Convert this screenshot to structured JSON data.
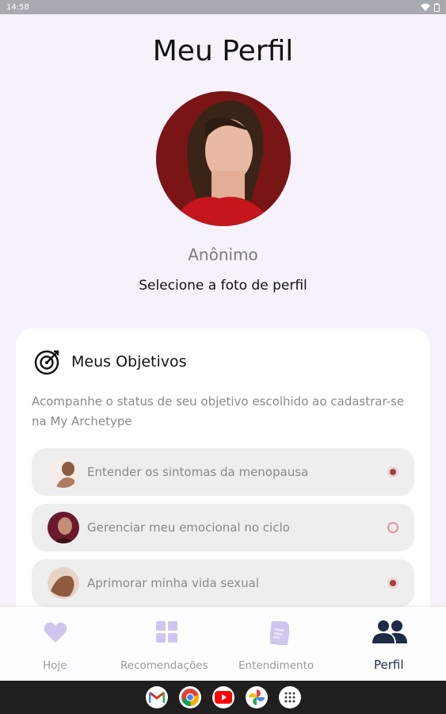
{
  "status_bar": {
    "time": "14:58"
  },
  "header": {
    "title": "Meu Perfil"
  },
  "profile": {
    "name": "Anônimo",
    "select_photo_label": "Selecione a foto de perfil"
  },
  "goals_card": {
    "title": "Meus Objetivos",
    "description": "Acompanhe o status de seu objetivo escolhido ao cadastrar-se na My Archetype",
    "items": [
      {
        "label": "Entender os sintomas da menopausa",
        "selected": true
      },
      {
        "label": "Gerenciar meu emocional no ciclo",
        "selected": false
      },
      {
        "label": "Aprimorar minha vida sexual",
        "selected": true
      }
    ]
  },
  "bottom_nav": {
    "items": [
      {
        "label": "Hoje",
        "icon": "heart-icon",
        "active": false
      },
      {
        "label": "Recomendações",
        "icon": "grid-icon",
        "active": false
      },
      {
        "label": "Entendimento",
        "icon": "document-icon",
        "active": false
      },
      {
        "label": "Perfil",
        "icon": "people-icon",
        "active": true
      }
    ]
  },
  "system_dock": {
    "apps": [
      "gmail-icon",
      "chrome-icon",
      "youtube-icon",
      "photos-icon",
      "app-drawer-icon"
    ]
  },
  "colors": {
    "accent": "#a5403e",
    "nav_inactive": "#cfc6ef",
    "nav_active": "#1f2b44",
    "background": "#f6f2fc"
  }
}
